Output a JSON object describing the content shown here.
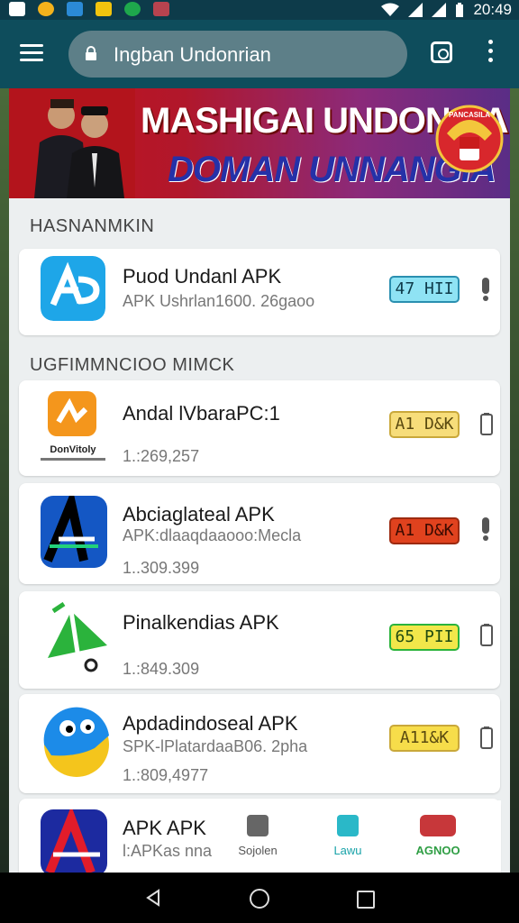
{
  "status": {
    "time": "20:49"
  },
  "toolbar": {
    "url": "Ingban Undonrian"
  },
  "banner": {
    "line1": "MASHIGAI UNDONSIA",
    "line2": "DOMAN UNNANGIA",
    "emblem_text": "PANCASILA"
  },
  "featured": {
    "title": "HASNANMKIN",
    "app": {
      "name": "Puod Undanl APK",
      "sub": "APK Ushrlan1600. 26gaoo",
      "badge": "47 HII",
      "badge_color": "#8fe3f4"
    }
  },
  "list": {
    "title": "UGFIMMNCIOO MIMCK",
    "apps": [
      {
        "name": "Andal lVbaraPC:1",
        "sub": "",
        "count": "1.:269,257",
        "badge": "A1 D&K",
        "badge_color": "#f7dd7a",
        "icon_text": "DonVitoly"
      },
      {
        "name": "Abciaglateal APK",
        "sub": "APK:dlaaqdaaooo:Mecla",
        "count": "1..309.399",
        "badge": "A1 D&K",
        "badge_color": "#e0421e"
      },
      {
        "name": "Pinalkendias APK",
        "sub": "",
        "count": "1.:849.309",
        "badge": "65 PII",
        "badge_color": "#f2e74a"
      },
      {
        "name": "Apdadindoseal APK",
        "sub": "SPK-lPlatardaaB06. 2pha",
        "count": "1.:809,4977",
        "badge": "A11&K",
        "badge_color": "#f7dd4a"
      },
      {
        "name": "APK APK",
        "sub": "l:APKas nna",
        "count": "",
        "badge": "",
        "badge_color": ""
      }
    ]
  },
  "bottom_tabs": [
    {
      "label": "Sojolen",
      "icon": "bookmark-icon"
    },
    {
      "label": "Lawu",
      "icon": "share-icon"
    },
    {
      "label": "AGNOO",
      "icon": "camera-icon"
    }
  ]
}
